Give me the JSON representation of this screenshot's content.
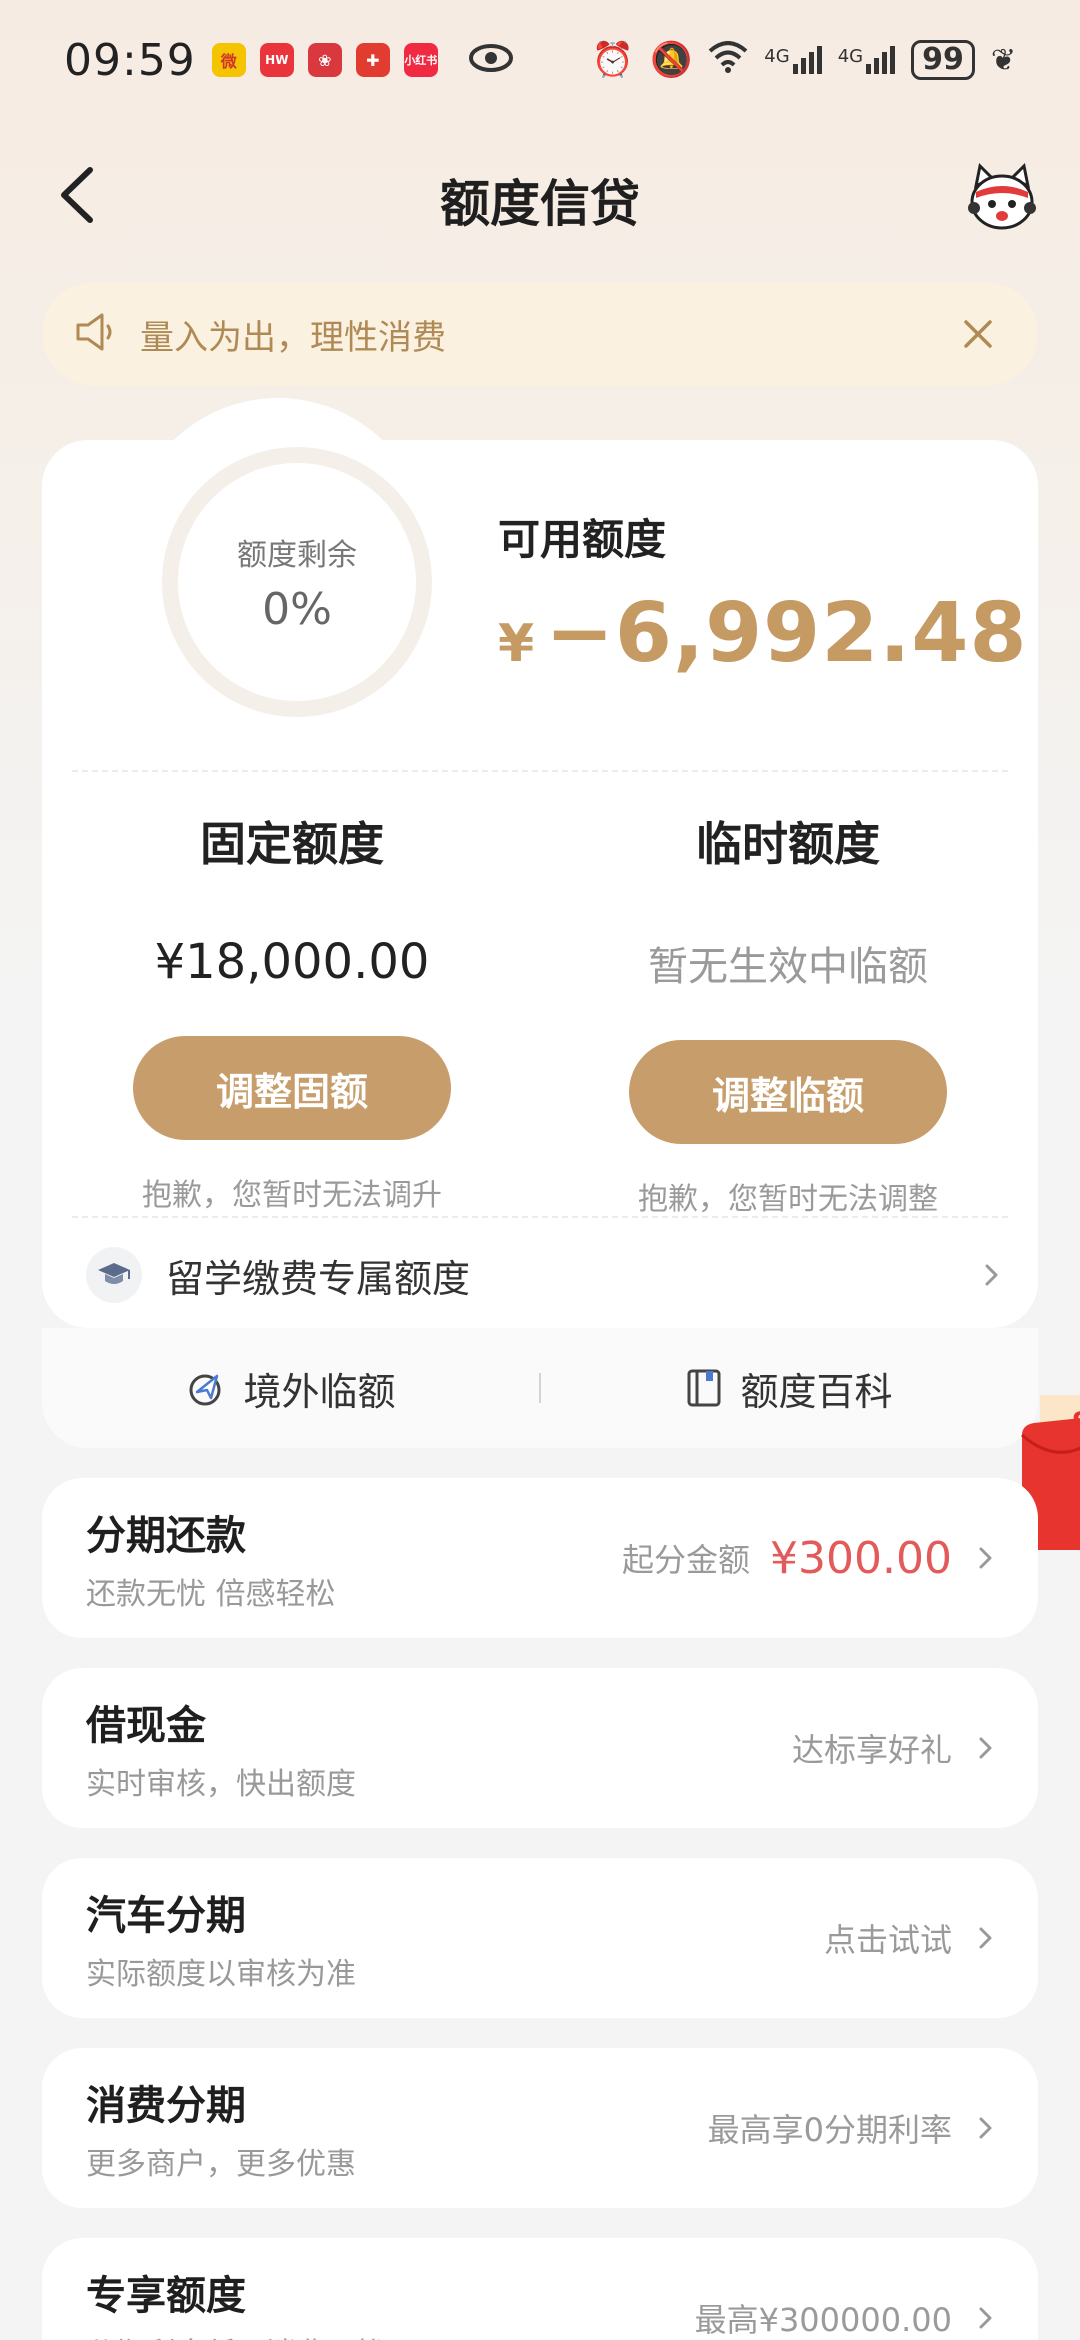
{
  "status_bar": {
    "time": "09:59",
    "app_icons": [
      {
        "name": "weibo-icon",
        "color": "#f5c400",
        "label": "微"
      },
      {
        "name": "huawei-icon",
        "color": "#e8343a",
        "label": "HW"
      },
      {
        "name": "app-flower-icon",
        "color": "#d9383f",
        "label": "❀"
      },
      {
        "name": "app-cross-icon",
        "color": "#e23b2f",
        "label": "✚"
      },
      {
        "name": "xiaohongshu-icon",
        "color": "#ef2a41",
        "label": "小红书"
      }
    ],
    "network": "4G",
    "battery": "99"
  },
  "header": {
    "title": "额度信贷"
  },
  "notice": {
    "text": "量入为出，理性消费"
  },
  "quota": {
    "ring_label": "额度剩余",
    "ring_value": "0%",
    "available_label": "可用额度",
    "available_currency": "¥",
    "available_amount": "−6,992.48",
    "fixed": {
      "title": "固定额度",
      "amount": "¥18,000.00",
      "button": "调整固额",
      "note": "抱歉，您暂时无法调升"
    },
    "temporary": {
      "title": "临时额度",
      "empty": "暂无生效中临额",
      "button": "调整临额",
      "note": "抱歉，您暂时无法调整"
    },
    "study_abroad": "留学缴费专属额度",
    "bottom_links": [
      "境外临额",
      "额度百科"
    ]
  },
  "services": [
    {
      "title": "分期还款",
      "subtitle": "还款无忧 倍感轻松",
      "hint": "起分金额",
      "price": "¥300.00"
    },
    {
      "title": "借现金",
      "subtitle": "实时审核，快出额度",
      "hint": "达标享好礼"
    },
    {
      "title": "汽车分期",
      "subtitle": "实际额度以审核为准",
      "hint": "点击试试"
    },
    {
      "title": "消费分期",
      "subtitle": "更多商户，更多优惠",
      "hint": "最高享0分期利率"
    },
    {
      "title": "专享额度",
      "subtitle": "分期利息低，消费无忧",
      "hint": "最高¥300000.00"
    }
  ],
  "colors": {
    "accent": "#c79e6b",
    "price_red": "#e35a5a",
    "notice_bg": "#fbf1e0"
  }
}
